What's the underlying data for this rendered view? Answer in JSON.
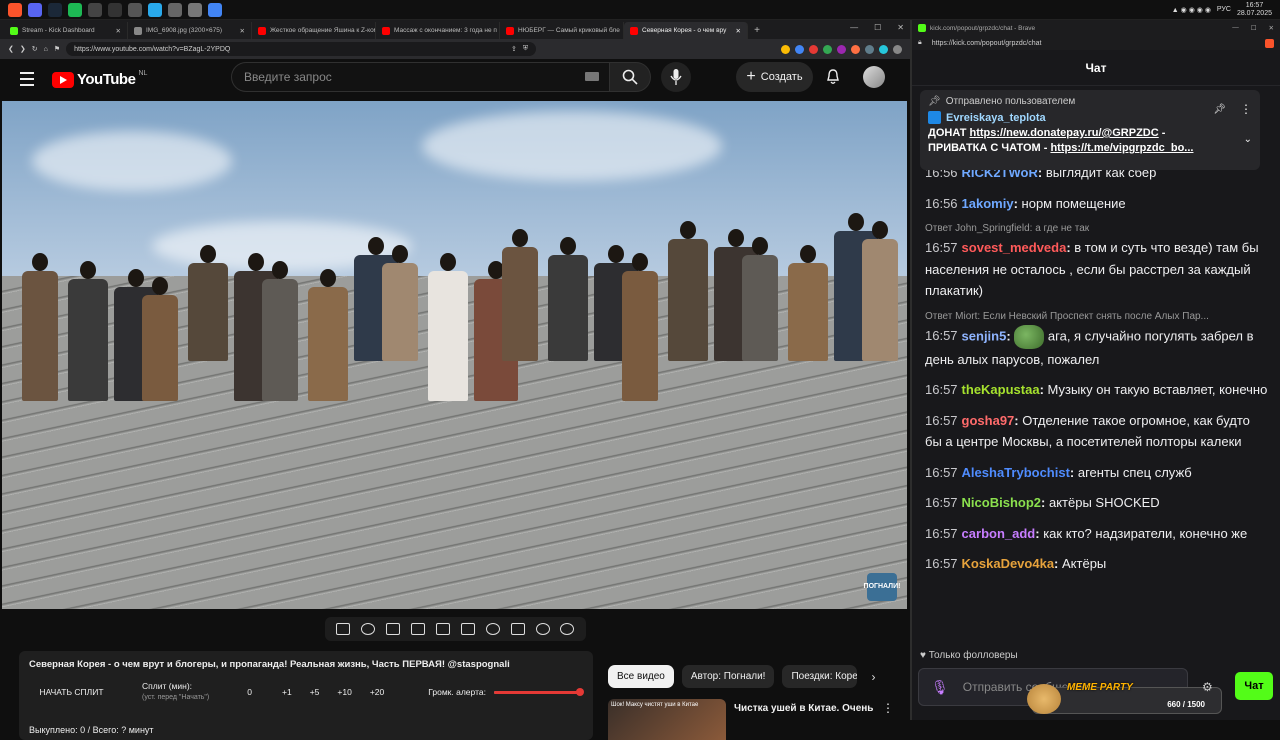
{
  "taskbar": {
    "icons": [
      "brave-icon",
      "discord-icon",
      "steam-icon",
      "spotify-icon",
      "app-icon",
      "app-icon",
      "app-icon",
      "telegram-icon",
      "app-icon",
      "app-icon",
      "app-icon"
    ],
    "lang": "РУС",
    "time": "16:57",
    "date": "28.07.2025"
  },
  "browser": {
    "tabs": [
      {
        "label": "Stream - Kick Dashboard",
        "color": "#53fc18"
      },
      {
        "label": "IMG_6908.jpg (3200×675)",
        "color": "#888888"
      },
      {
        "label": "Жесткое обращение Яшина к Z-ком",
        "color": "#ff0000"
      },
      {
        "label": "Массаж с окончанием: 3 года не п",
        "color": "#ff0000"
      },
      {
        "label": "НЮБЕРГ — Самый криковый бле",
        "color": "#ff0000"
      },
      {
        "label": "Северная Корея - о чем вру",
        "color": "#ff0000"
      }
    ],
    "url": "https://www.youtube.com/watch?v=BZagL-2YPDQ"
  },
  "youtube": {
    "logo_text": "YouTube",
    "region": "NL",
    "search_placeholder": "Введите запрос",
    "create_label": "Создать",
    "video_watermark": "ПОГНАЛИ!",
    "panel": {
      "title": "Северная Корея - о чем врут и блогеры, и пропаганда! Реальная жизнь, Часть ПЕРВАЯ! @staspognali",
      "start_split": "НАЧАТЬ СПЛИТ",
      "split_label": "Сплит (мин):",
      "split_hint": "(уст. перед \"Начать\")",
      "split_value": "0",
      "increments": [
        "+1",
        "+5",
        "+10",
        "+20"
      ],
      "alert_volume_label": "Громк. алерта:",
      "alert_volume": 1.0,
      "footer": "Выкуплено: 0 / Всего: ? минут"
    },
    "chips": [
      {
        "label": "Все видео",
        "selected": true
      },
      {
        "label": "Автор: Погнали!",
        "selected": false
      },
      {
        "label": "Поездки: Коре",
        "selected": false
      }
    ],
    "recommended": {
      "title": "Чистка ушей в Китае. Очень",
      "thumb_text": "Шок! Максу чистят уши в Китае"
    }
  },
  "kick": {
    "window_title": "kick.com/popout/grpzdc/chat - Brave",
    "url": "https://kick.com/popout/grpzdc/chat",
    "chat_title": "Чат",
    "pinned": {
      "label": "Отправлено пользователем",
      "user": "Evreiskaya_teplota",
      "line1_prefix": "ДОНАТ ",
      "line1_link": "https://new.donatepay.ru/@GRPZDC",
      "line1_suffix": " -",
      "line2_prefix": "ПРИВАТКА С ЧАТОМ - ",
      "line2_link": "https://t.me/vipgrpzdc_bo..."
    },
    "messages": [
      {
        "time": "16:56",
        "user": "RICK2TWoR",
        "color": "#6fa8ff",
        "text": "выглядит как сбер",
        "reply": ""
      },
      {
        "time": "16:56",
        "user": "1akomiy",
        "color": "#6fa8ff",
        "text": "норм помещение",
        "reply": ""
      },
      {
        "time": "16:57",
        "user": "sovest_medveda",
        "color": "#ff5a5a",
        "text": "в том и суть что везде) там бы населения не осталось , если бы расстрел за каждый плакатик)",
        "reply": "Ответ John_Springfield: а где не так"
      },
      {
        "time": "16:57",
        "user": "senjin5",
        "color": "#8fb4ff",
        "text": " ага, я случайно погулять забрел в день алых парусов, пожалел",
        "reply": "Ответ Miort: Если Невский Проспект снять после Алых Пар...",
        "emote": "pepe-emote"
      },
      {
        "time": "16:57",
        "user": "theKapustaa",
        "color": "#a6e22e",
        "text": "Музыку он такую вставляет, конечно",
        "reply": ""
      },
      {
        "time": "16:57",
        "user": "gosha97",
        "color": "#ff6b6b",
        "text": "Отделение такое огромное, как будто бы а центре Москвы, а посетителей полторы калеки",
        "reply": ""
      },
      {
        "time": "16:57",
        "user": "AleshaTrybochist",
        "color": "#4f8cff",
        "text": "агенты спец служб",
        "reply": ""
      },
      {
        "time": "16:57",
        "user": "NicoBishop2",
        "color": "#8be04e",
        "text": "актёры SHOCKED",
        "reply": ""
      },
      {
        "time": "16:57",
        "user": "carbon_add",
        "color": "#c77dff",
        "text": "как кто? надзиратели, конечно же",
        "reply": ""
      },
      {
        "time": "16:57",
        "user": "KoskaDevo4ka",
        "color": "#e6a23c",
        "text": "Актёры",
        "reply": ""
      }
    ],
    "followers_only": "Только фолловеры",
    "input_placeholder": "Отправить сообщение",
    "meme_party": {
      "label": "MEME PARTY",
      "progress": "660 / 1500"
    },
    "send_label": "Чат"
  }
}
